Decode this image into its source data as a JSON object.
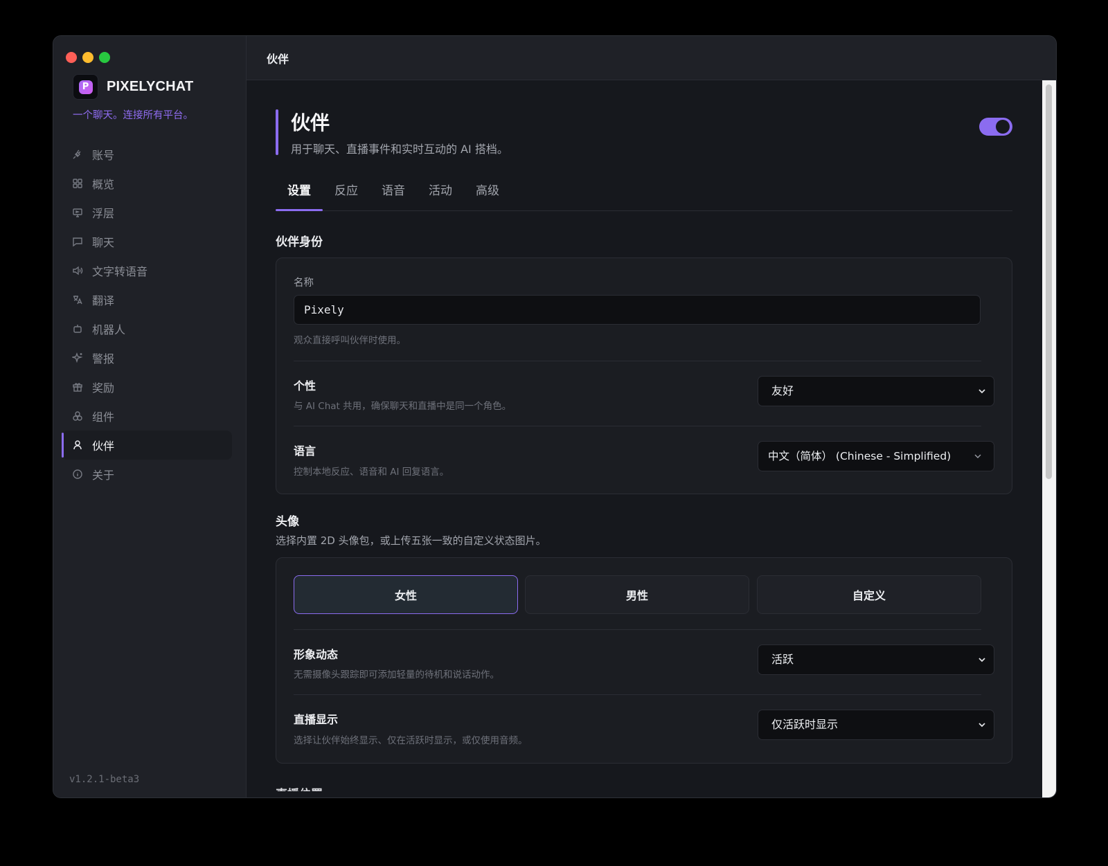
{
  "app": {
    "name": "PIXELYCHAT",
    "tagline": "一个聊天。连接所有平台。",
    "version": "v1.2.1-beta3"
  },
  "sidebar": {
    "items": [
      {
        "label": "账号",
        "icon": "plug-icon"
      },
      {
        "label": "概览",
        "icon": "grid-icon"
      },
      {
        "label": "浮层",
        "icon": "monitor-icon"
      },
      {
        "label": "聊天",
        "icon": "chat-icon"
      },
      {
        "label": "文字转语音",
        "icon": "speaker-icon"
      },
      {
        "label": "翻译",
        "icon": "translate-icon"
      },
      {
        "label": "机器人",
        "icon": "robot-icon"
      },
      {
        "label": "警报",
        "icon": "sparkle-icon"
      },
      {
        "label": "奖励",
        "icon": "gift-icon"
      },
      {
        "label": "组件",
        "icon": "components-icon"
      },
      {
        "label": "伙伴",
        "icon": "user-icon",
        "active": true
      },
      {
        "label": "关于",
        "icon": "info-icon"
      }
    ]
  },
  "header": {
    "title": "伙伴"
  },
  "page": {
    "title": "伙伴",
    "subtitle": "用于聊天、直播事件和实时互动的 AI 搭档。",
    "enabled": true
  },
  "tabs": [
    {
      "label": "设置",
      "active": true
    },
    {
      "label": "反应"
    },
    {
      "label": "语音"
    },
    {
      "label": "活动"
    },
    {
      "label": "高级"
    }
  ],
  "identity": {
    "section_title": "伙伴身份",
    "name_label": "名称",
    "name_value": "Pixely",
    "name_hint": "观众直接呼叫伙伴时使用。",
    "personality_title": "个性",
    "personality_hint": "与 AI Chat 共用，确保聊天和直播中是同一个角色。",
    "personality_value": "友好",
    "language_title": "语言",
    "language_hint": "控制本地反应、语音和 AI 回复语言。",
    "language_value": "中文（简体） (Chinese - Simplified)"
  },
  "avatar": {
    "section_title": "头像",
    "section_sub": "选择内置 2D 头像包，或上传五张一致的自定义状态图片。",
    "options": [
      {
        "label": "女性",
        "active": true
      },
      {
        "label": "男性"
      },
      {
        "label": "自定义"
      }
    ],
    "motion_title": "形象动态",
    "motion_hint": "无需摄像头跟踪即可添加轻量的待机和说话动作。",
    "motion_value": "活跃",
    "stream_title": "直播显示",
    "stream_hint": "选择让伙伴始终显示、仅在活跃时显示，或仅使用音频。",
    "stream_value": "仅活跃时显示"
  },
  "next_section": {
    "title": "直播位置"
  },
  "colors": {
    "accent": "#8b6cf0",
    "bg": "#16181d",
    "sidebar": "#1f2127"
  }
}
